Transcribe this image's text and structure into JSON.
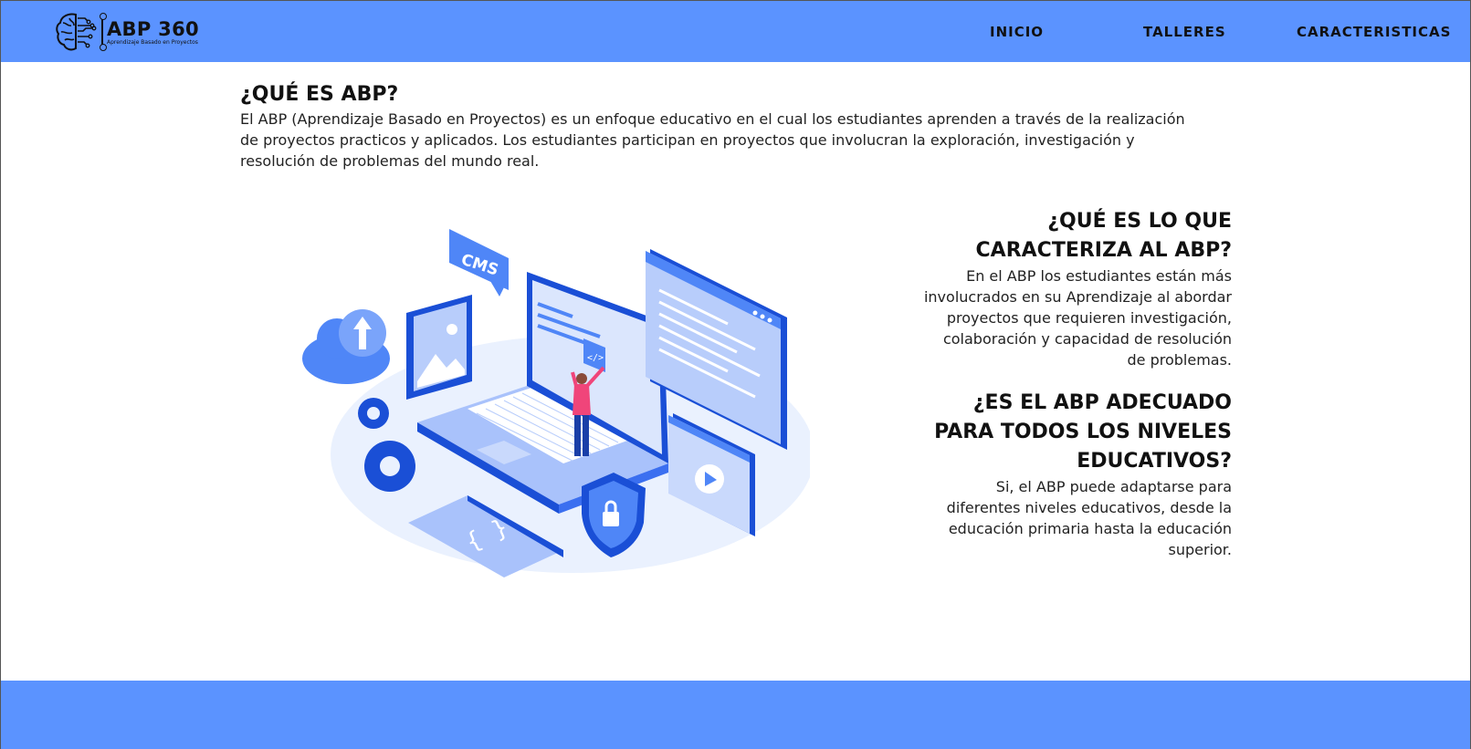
{
  "header": {
    "logo_title": "ABP 360",
    "logo_subtitle": "Aprendizaje Basado en Proyectos",
    "nav": [
      "INICIO",
      "TALLERES",
      "CARACTERISTICAS"
    ]
  },
  "intro": {
    "title": "¿QUÉ ES ABP?",
    "text": "El ABP (Aprendizaje Basado en Proyectos) es un enfoque educativo en el cual los estudiantes aprenden a través de la realización de proyectos practicos y aplicados. Los estudiantes participan en proyectos que involucran la exploración, investigación y resolución de problemas del mundo real."
  },
  "illustration": {
    "cms_label": "CMS",
    "code_label": "</>",
    "braces_label": "{ }"
  },
  "side": {
    "q1_title": "¿QUÉ ES LO QUE CARACTERIZA AL ABP?",
    "q1_text": "En el ABP los estudiantes están más involucrados en su Aprendizaje al abordar proyectos que requieren investigación, colaboración y capacidad de resolución de problemas.",
    "q2_title": "¿ES EL ABP ADECUADO PARA TODOS LOS NIVELES EDUCATIVOS?",
    "q2_text": "Si, el ABP puede adaptarse para diferentes niveles educativos, desde la educación primaria hasta la educación superior."
  },
  "colors": {
    "brand_blue": "#5b93ff",
    "illustration_dark": "#1a4fd6",
    "illustration_mid": "#4f86f7",
    "illustration_light": "#b8cdfb",
    "person_shirt": "#f0457a"
  }
}
